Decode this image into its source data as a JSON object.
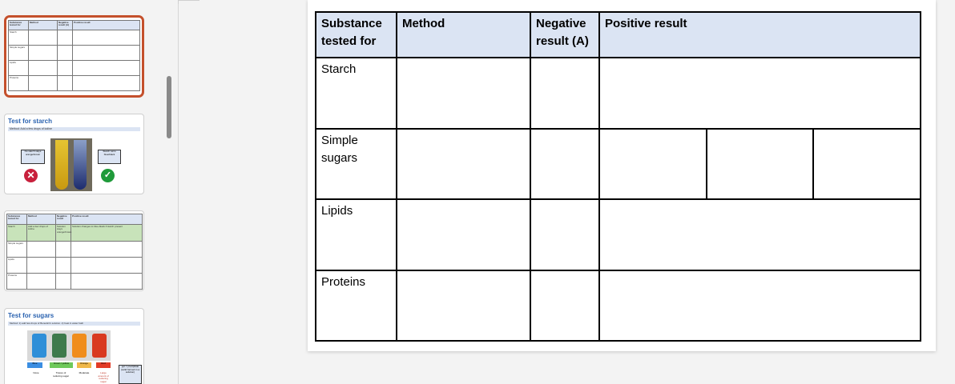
{
  "thumbnails": [
    {
      "headers": [
        "Substance tested for",
        "Method",
        "Negative result (A)",
        "Positive result"
      ],
      "rows": [
        "Starch",
        "Simple sugars",
        "Lipids",
        "Proteins"
      ]
    },
    {
      "title": "Test for starch",
      "method_text": "Method: Add a few drops of iodine",
      "box_left": "No starch stays orange/brown",
      "box_right": "Starch turns blue/black"
    },
    {
      "headers": [
        "Substance tested for",
        "Method",
        "Negative result",
        "Positive result"
      ],
      "starch_row": [
        "Starch",
        "Add a few drops of iodine",
        "Solution stays orange/brown",
        "Solution changes to blue-black if starch present"
      ],
      "rows": [
        "Simple sugars",
        "Lipids",
        "Proteins"
      ]
    },
    {
      "title": "Test for sugars",
      "method_text": "Method: 1) add few drops of Benedict's solution. 2) heat in water bath",
      "tube_labels": [
        "Blue",
        "Green / yellow",
        "Orange",
        "Red"
      ],
      "captions": [
        "None",
        "Traces of reducing sugar",
        "Moderate",
        "Large amount of reducing sugar"
      ],
      "note": "ppt = precipitate (solid formed in a solution)"
    }
  ],
  "table": {
    "headers": [
      "Substance tested for",
      "Method",
      "Negative result (A)",
      "Positive result"
    ],
    "rows": [
      "Starch",
      "Simple sugars",
      "Lipids",
      "Proteins"
    ]
  }
}
